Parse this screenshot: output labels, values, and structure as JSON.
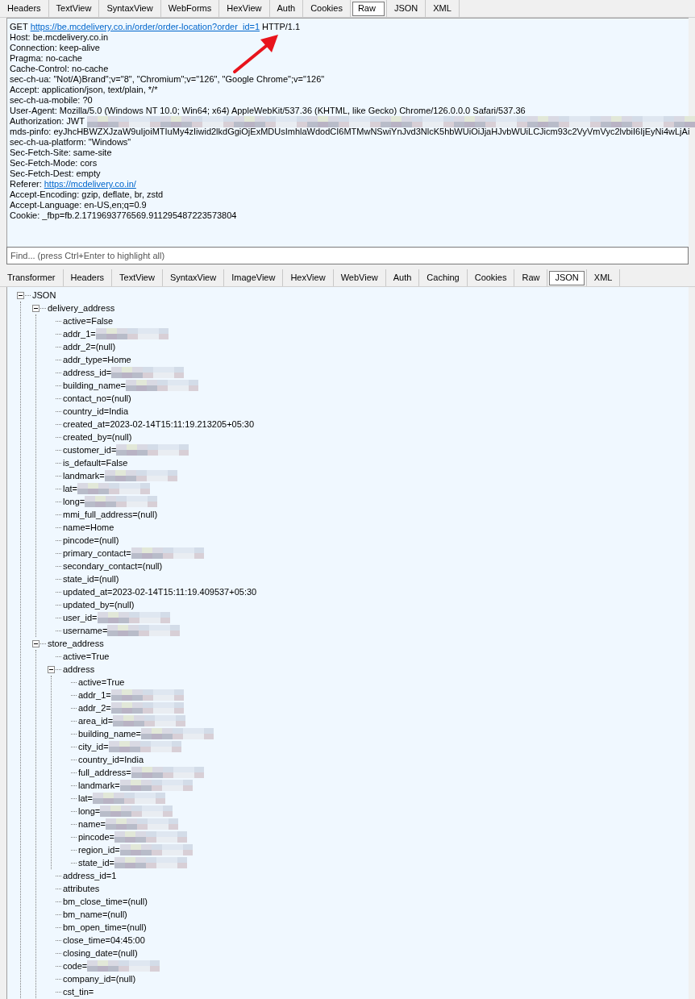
{
  "request_tabs": [
    {
      "label": "Headers",
      "selected": false
    },
    {
      "label": "TextView",
      "selected": false
    },
    {
      "label": "SyntaxView",
      "selected": false
    },
    {
      "label": "WebForms",
      "selected": false
    },
    {
      "label": "HexView",
      "selected": false
    },
    {
      "label": "Auth",
      "selected": false
    },
    {
      "label": "Cookies",
      "selected": false
    },
    {
      "label": "Raw",
      "selected": true
    },
    {
      "label": "JSON",
      "selected": false
    },
    {
      "label": "XML",
      "selected": false
    }
  ],
  "request_lines": [
    {
      "text": "GET",
      "link": "https://be.mcdelivery.co.in/order/order-location?order_id=1",
      "suffix": "HTTP/1.1"
    },
    {
      "text": "Host: be.mcdelivery.co.in"
    },
    {
      "text": "Connection: keep-alive"
    },
    {
      "text": "Pragma: no-cache"
    },
    {
      "text": "Cache-Control: no-cache"
    },
    {
      "text": "sec-ch-ua: \"Not/A)Brand\";v=\"8\", \"Chromium\";v=\"126\", \"Google Chrome\";v=\"126\""
    },
    {
      "text": "Accept: application/json, text/plain, */*"
    },
    {
      "text": "sec-ch-ua-mobile: ?0"
    },
    {
      "text": "User-Agent: Mozilla/5.0 (Windows NT 10.0; Win64; x64) AppleWebKit/537.36 (KHTML, like Gecko) Chrome/126.0.0.0 Safari/537.36"
    },
    {
      "text": "Authorization: JWT",
      "redacted": true
    },
    {
      "text": "mds-pinfo: eyJhcHBWZXJzaW9uIjoiMTIuMy4zIiwid2lkdGgiOjExMDUsImhlaWdodCI6MTMwNSwiYnJvd3NlcK5hbWUiOiJjaHJvbWUiLCJicm93c2VyVmVyc2lvbiI6IjEyNi4wLjAi"
    },
    {
      "text": "sec-ch-ua-platform: \"Windows\""
    },
    {
      "text": "Sec-Fetch-Site: same-site"
    },
    {
      "text": "Sec-Fetch-Mode: cors"
    },
    {
      "text": "Sec-Fetch-Dest: empty"
    },
    {
      "text": "Referer:",
      "link": "https://mcdelivery.co.in/"
    },
    {
      "text": "Accept-Encoding: gzip, deflate, br, zstd"
    },
    {
      "text": "Accept-Language: en-US,en;q=0.9"
    },
    {
      "text": "Cookie: _fbp=fb.2.1719693776569.911295487223573804"
    }
  ],
  "find": {
    "placeholder": "Find... (press Ctrl+Enter to highlight all)"
  },
  "response_tabs": [
    {
      "label": "Transformer",
      "selected": false
    },
    {
      "label": "Headers",
      "selected": false
    },
    {
      "label": "TextView",
      "selected": false
    },
    {
      "label": "SyntaxView",
      "selected": false
    },
    {
      "label": "ImageView",
      "selected": false
    },
    {
      "label": "HexView",
      "selected": false
    },
    {
      "label": "WebView",
      "selected": false
    },
    {
      "label": "Auth",
      "selected": false
    },
    {
      "label": "Caching",
      "selected": false
    },
    {
      "label": "Cookies",
      "selected": false
    },
    {
      "label": "Raw",
      "selected": false
    },
    {
      "label": "JSON",
      "selected": true
    },
    {
      "label": "XML",
      "selected": false
    }
  ],
  "tree": [
    {
      "label": "JSON",
      "expanded": true,
      "children": [
        {
          "label": "delivery_address",
          "expanded": true,
          "children": [
            {
              "label": "active=False"
            },
            {
              "label": "addr_1=",
              "redacted": true
            },
            {
              "label": "addr_2=(null)"
            },
            {
              "label": "addr_type=Home"
            },
            {
              "label": "address_id=",
              "redacted": true
            },
            {
              "label": "building_name=",
              "redacted": true
            },
            {
              "label": "contact_no=(null)"
            },
            {
              "label": "country_id=India"
            },
            {
              "label": "created_at=2023-02-14T15:11:19.213205+05:30"
            },
            {
              "label": "created_by=(null)"
            },
            {
              "label": "customer_id=",
              "redacted": true
            },
            {
              "label": "is_default=False"
            },
            {
              "label": "landmark=",
              "redacted": true
            },
            {
              "label": "lat=",
              "redacted": true
            },
            {
              "label": "long=",
              "redacted": true
            },
            {
              "label": "mmi_full_address=(null)"
            },
            {
              "label": "name=Home"
            },
            {
              "label": "pincode=(null)"
            },
            {
              "label": "primary_contact=",
              "redacted": true
            },
            {
              "label": "secondary_contact=(null)"
            },
            {
              "label": "state_id=(null)"
            },
            {
              "label": "updated_at=2023-02-14T15:11:19.409537+05:30"
            },
            {
              "label": "updated_by=(null)"
            },
            {
              "label": "user_id=",
              "redacted": true
            },
            {
              "label": "username=",
              "redacted": true
            }
          ]
        },
        {
          "label": "store_address",
          "expanded": true,
          "children": [
            {
              "label": "active=True"
            },
            {
              "label": "address",
              "expanded": true,
              "children": [
                {
                  "label": "active=True"
                },
                {
                  "label": "addr_1=",
                  "redacted": true
                },
                {
                  "label": "addr_2=",
                  "redacted": true
                },
                {
                  "label": "area_id=",
                  "redacted": true
                },
                {
                  "label": "building_name=",
                  "redacted": true
                },
                {
                  "label": "city_id=",
                  "redacted": true
                },
                {
                  "label": "country_id=India"
                },
                {
                  "label": "full_address=",
                  "redacted": true
                },
                {
                  "label": "landmark=",
                  "redacted": true
                },
                {
                  "label": "lat=",
                  "redacted": true
                },
                {
                  "label": "long=",
                  "redacted": true
                },
                {
                  "label": "name=",
                  "redacted": true
                },
                {
                  "label": "pincode=",
                  "redacted": true
                },
                {
                  "label": "region_id=",
                  "redacted": true
                },
                {
                  "label": "state_id=",
                  "redacted": true
                }
              ]
            },
            {
              "label": "address_id=1"
            },
            {
              "label": "attributes"
            },
            {
              "label": "bm_close_time=(null)"
            },
            {
              "label": "bm_name=(null)"
            },
            {
              "label": "bm_open_time=(null)"
            },
            {
              "label": "close_time=04:45:00"
            },
            {
              "label": "closing_date=(null)"
            },
            {
              "label": "code=",
              "redacted": true
            },
            {
              "label": "company_id=(null)"
            },
            {
              "label": "cst_tin="
            }
          ]
        }
      ]
    }
  ]
}
